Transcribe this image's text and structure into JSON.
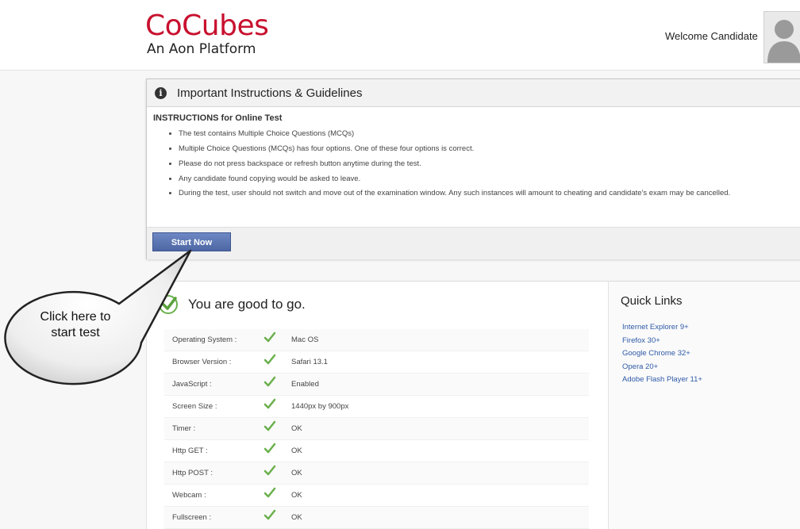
{
  "header": {
    "logo_main": "CoCubes",
    "logo_sub": "An Aon Platform",
    "welcome": "Welcome Candidate"
  },
  "instructions": {
    "title": "Important Instructions & Guidelines",
    "subtitle": "INSTRUCTIONS for Online Test",
    "items": [
      "The test contains Multiple Choice Questions (MCQs)",
      "Multiple Choice Questions (MCQs) has four options. One of these four options is correct.",
      "Please do not press backspace or refresh button anytime during the test.",
      "Any candidate found copying would be asked to leave.",
      "During the test, user should not switch and move out of the examination window. Any such instances will amount to cheating and candidate's exam may be cancelled."
    ],
    "start_label": "Start Now"
  },
  "system_check": {
    "status": "You are good to go.",
    "rows": [
      {
        "label": "Operating System :",
        "value": "Mac OS"
      },
      {
        "label": "Browser Version :",
        "value": "Safari 13.1"
      },
      {
        "label": "JavaScript :",
        "value": "Enabled"
      },
      {
        "label": "Screen Size :",
        "value": "1440px by 900px"
      },
      {
        "label": "Timer :",
        "value": "OK"
      },
      {
        "label": "Http GET :",
        "value": "OK"
      },
      {
        "label": "Http POST :",
        "value": "OK"
      },
      {
        "label": "Webcam :",
        "value": "OK"
      },
      {
        "label": "Fullscreen :",
        "value": "OK"
      }
    ]
  },
  "quick_links": {
    "title": "Quick Links",
    "items": [
      "Internet Explorer 9+",
      "Firefox 30+",
      "Google Chrome 32+",
      "Opera 20+",
      "Adobe Flash Player 11+"
    ]
  },
  "callout": {
    "line1": "Click here to",
    "line2": "start test"
  },
  "colors": {
    "brand": "#c8102e",
    "button": "#5572b0",
    "check": "#6ab04c",
    "link": "#2f5aa8"
  },
  "icons": [
    "info-icon",
    "checkmark-circle-icon",
    "checkmark-icon",
    "user-avatar-icon"
  ]
}
